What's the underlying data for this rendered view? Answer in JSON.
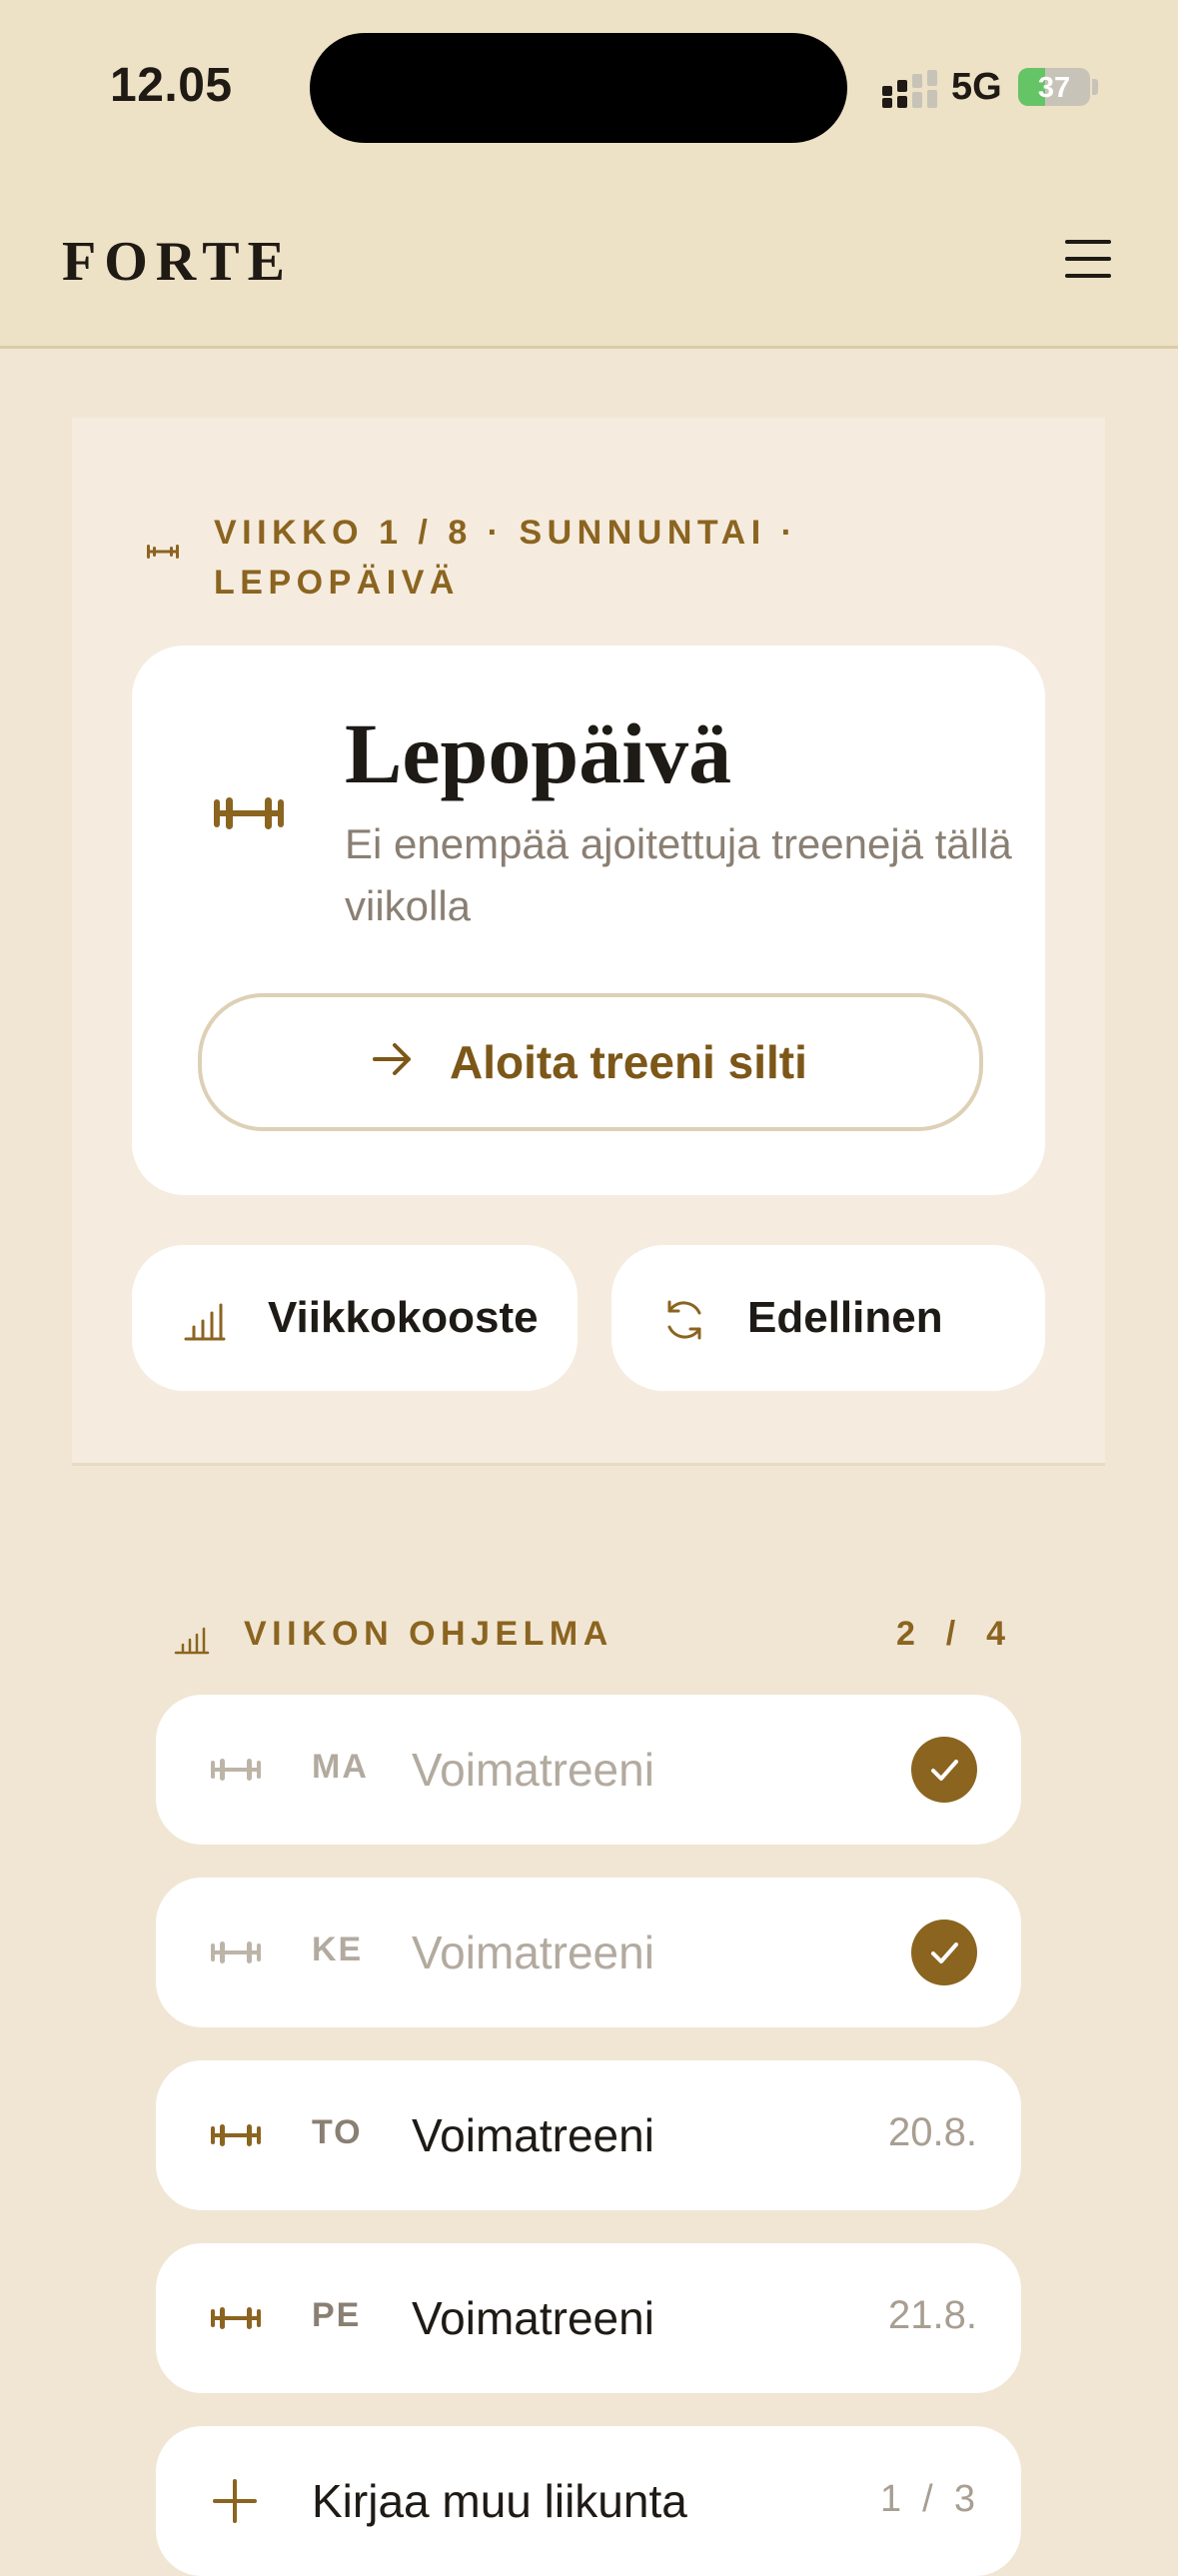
{
  "status_bar": {
    "time": "12.05",
    "network": "5G",
    "battery_percent": "37",
    "battery_level": 0.37,
    "battery_color": "#65c466"
  },
  "header": {
    "brand": "FORTE",
    "menu_icon": "hamburger-menu-icon"
  },
  "today": {
    "kicker": "VIIKKO 1 / 8 · SUNNUNTAI · LEPOPÄIVÄ",
    "kicker_icon": "dumbbell-icon",
    "card": {
      "icon": "dumbbell-icon",
      "title": "Lepopäivä",
      "subtitle": "Ei enempää ajoitettuja treenejä tällä viikolla",
      "button_label": "Aloita treeni silti",
      "button_icon": "arrow-right-icon"
    },
    "quick_actions": [
      {
        "label": "Viikkokooste",
        "icon": "bar-chart-icon"
      },
      {
        "label": "Edellinen",
        "icon": "refresh-icon"
      }
    ]
  },
  "program": {
    "title": "VIIKON OHJELMA",
    "icon": "bar-chart-icon",
    "count": "2  /  4",
    "items": [
      {
        "day": "MA",
        "name": "Voimatreeni",
        "date": "",
        "done": true
      },
      {
        "day": "KE",
        "name": "Voimatreeni",
        "date": "",
        "done": true
      },
      {
        "day": "TO",
        "name": "Voimatreeni",
        "date": "20.8.",
        "done": false
      },
      {
        "day": "PE",
        "name": "Voimatreeni",
        "date": "21.8.",
        "done": false
      }
    ],
    "log_other": {
      "label": "Kirjaa muu liikunta",
      "count": "1  /  3",
      "icon": "plus-icon"
    }
  },
  "colors": {
    "accent": "#8b6420",
    "header_background": "#ede1c6",
    "page_background": "#f0e6d3",
    "panel_background": "#f5ecdf",
    "card_background": "#ffffff",
    "muted_text": "#a89e91"
  }
}
